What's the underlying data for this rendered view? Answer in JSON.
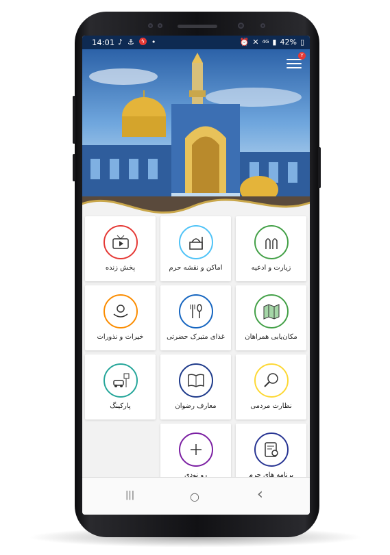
{
  "status_bar": {
    "time": "14:01",
    "left_icons": [
      "music-note-icon",
      "anchor-icon",
      "flash-icon",
      "dot-icon"
    ],
    "network": "4G",
    "battery": "42%"
  },
  "header": {
    "notification_count": "Y",
    "menu_icon": "hamburger-icon"
  },
  "grid": {
    "tiles": [
      {
        "label": "پخش زنده",
        "icon": "tv-icon",
        "color": "#e53935"
      },
      {
        "label": "اماکن و نقشه حرم",
        "icon": "shrine-icon",
        "color": "#4fc3f7"
      },
      {
        "label": "زیارت و ادعیه",
        "icon": "praying-hands-icon",
        "color": "#43a047"
      },
      {
        "label": "خیرات و نذورات",
        "icon": "donation-icon",
        "color": "#fb8c00"
      },
      {
        "label": "غذای متبرک حضرتی",
        "icon": "cutlery-icon",
        "color": "#1565c0"
      },
      {
        "label": "مکان‌یابی همراهان",
        "icon": "map-icon",
        "color": "#43a047"
      },
      {
        "label": "پارکینگ",
        "icon": "parking-icon",
        "color": "#26a69a"
      },
      {
        "label": "معارف رضوان",
        "icon": "book-icon",
        "color": "#1e3a8a"
      },
      {
        "label": "نظارت مردمی",
        "icon": "magnifier-icon",
        "color": "#fdd835"
      },
      {
        "label": "رو نودی",
        "icon": "plus-icon",
        "color": "#7b1fa2"
      },
      {
        "label": "برنامه های حرم",
        "icon": "schedule-icon",
        "color": "#283593"
      }
    ]
  },
  "nav_bar": {
    "recent": "|||",
    "home": "○",
    "back": "‹"
  }
}
